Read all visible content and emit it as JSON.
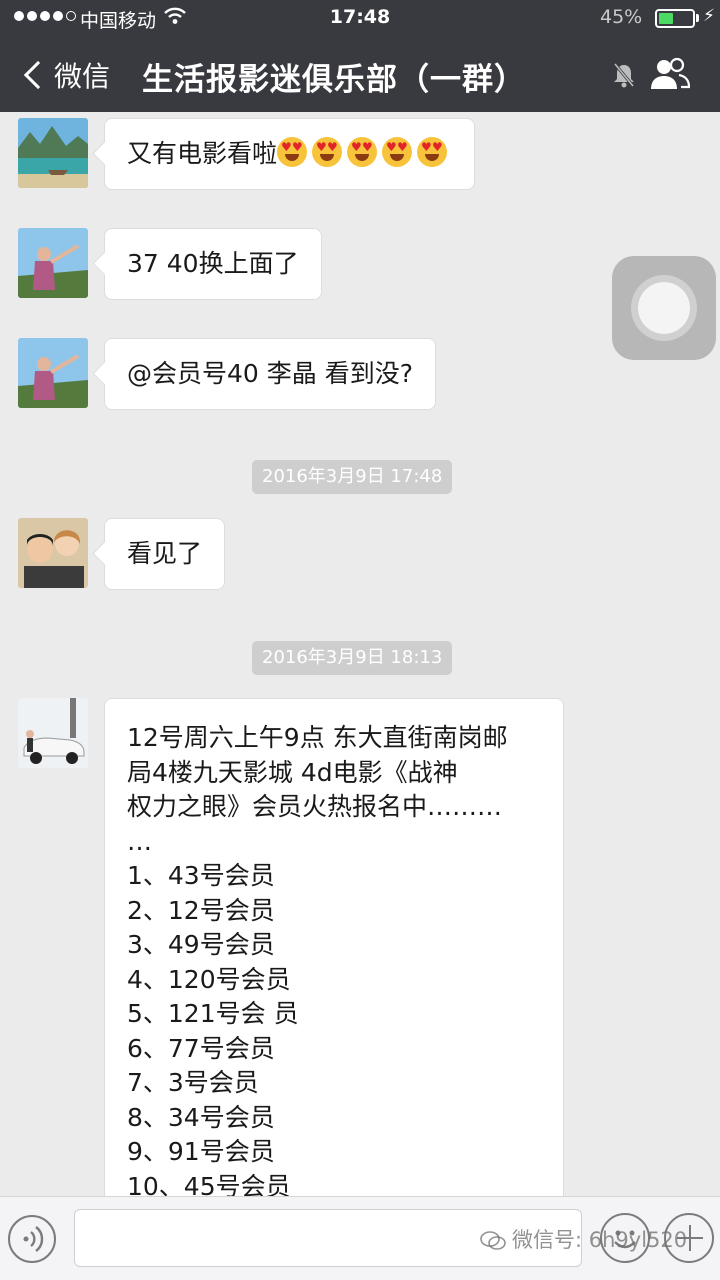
{
  "status_bar": {
    "carrier": "中国移动",
    "time": "17:48",
    "battery": "45%",
    "battery_level": 0.45
  },
  "nav": {
    "back_label": "微信",
    "title": "生活报影迷俱乐部（一群）"
  },
  "messages": [
    {
      "text": "又有电影看啦",
      "emoji_count": 5
    },
    {
      "text": "37 40换上面了"
    },
    {
      "text": "@会员号40 李晶 看到没?"
    },
    {
      "text": "看见了"
    }
  ],
  "timestamps": [
    "2016年3月9日 17:48",
    "2016年3月9日 18:13"
  ],
  "long_message": {
    "intro_lines": [
      "12号周六上午9点 东大直街南岗邮",
      "局4楼九天影城   4d电影《战神",
      "权力之眼》会员火热报名中………",
      "…"
    ],
    "members": [
      "1、43号会员",
      "2、12号会员",
      "3、49号会员",
      "4、120号会员",
      "5、121号会 员",
      "6、77号会员",
      "7、3号会员",
      "8、34号会员",
      "9、91号会员",
      "10、45号会员"
    ]
  },
  "watermark": "微信号: 6h9yl520",
  "colors": {
    "nav_bg": "#393a3f",
    "chat_bg": "#ebebeb",
    "bubble": "#ffffff",
    "battery_fill": "#4cd964"
  },
  "icons": [
    "back-chevron-icon",
    "wifi-icon",
    "mute-icon",
    "group-members-icon",
    "voice-icon",
    "emoji-icon",
    "plus-icon",
    "heart-eyes-emoji-icon",
    "assistive-touch-icon"
  ]
}
